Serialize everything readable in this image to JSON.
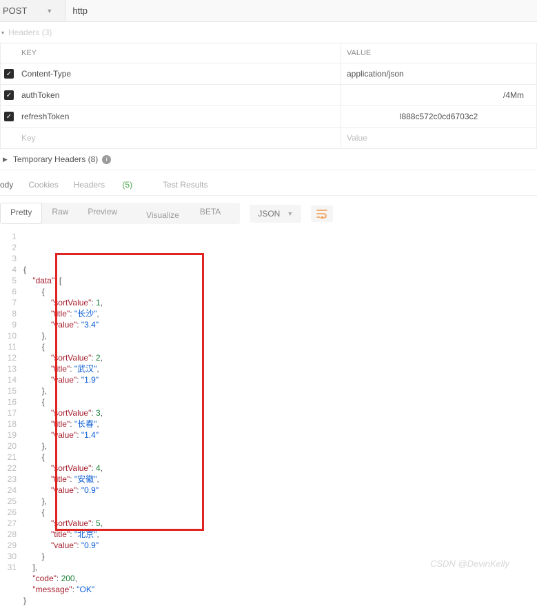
{
  "method": "POST",
  "url": "http",
  "headers_section_label": "Headers (3)",
  "headers_columns": {
    "key": "KEY",
    "value": "VALUE"
  },
  "headers": [
    {
      "enabled": true,
      "key": "Content-Type",
      "value": "application/json"
    },
    {
      "enabled": true,
      "key": "authToken",
      "value": "/4Mm"
    },
    {
      "enabled": true,
      "key": "refreshToken",
      "value": "l888c572c0cd6703c2"
    }
  ],
  "placeholder": {
    "key": "Key",
    "value": "Value"
  },
  "temporary_headers_label": "Temporary Headers (8)",
  "response_tabs": {
    "body": "ody",
    "cookies": "Cookies",
    "headers": "Headers",
    "headers_count": "(5)",
    "tests": "Test Results"
  },
  "view_modes": {
    "pretty": "Pretty",
    "raw": "Raw",
    "preview": "Preview",
    "visualize": "Visualize",
    "beta": "BETA"
  },
  "lang": "JSON",
  "response_json": {
    "data": [
      {
        "sortValue": 1,
        "title": "长沙",
        "value": "3.4"
      },
      {
        "sortValue": 2,
        "title": "武汉",
        "value": "1.9"
      },
      {
        "sortValue": 3,
        "title": "长春",
        "value": "1.4"
      },
      {
        "sortValue": 4,
        "title": "安徽",
        "value": "0.9"
      },
      {
        "sortValue": 5,
        "title": "北京",
        "value": "0.9"
      }
    ],
    "code": 200,
    "message": "OK"
  },
  "watermark": "CSDN @DevinKelly"
}
